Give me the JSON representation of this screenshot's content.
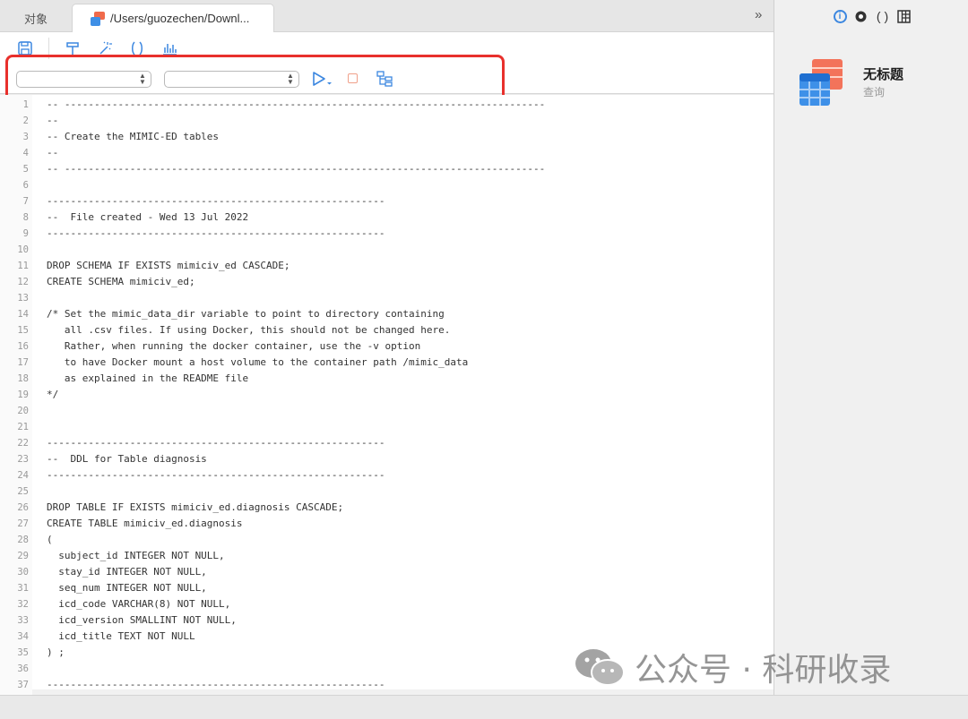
{
  "tabs": {
    "objects_label": "对象",
    "file_label": "/Users/guozechen/Downl...",
    "expand_glyph": "»"
  },
  "editor": {
    "lines": [
      {
        "n": "1",
        "text": "-- ---------------------------------------------------------------------------------"
      },
      {
        "n": "2",
        "text": "--"
      },
      {
        "n": "3",
        "text": "-- Create the MIMIC-ED tables"
      },
      {
        "n": "4",
        "text": "--"
      },
      {
        "n": "5",
        "text": "-- ---------------------------------------------------------------------------------"
      },
      {
        "n": "6",
        "text": ""
      },
      {
        "n": "7",
        "text": "---------------------------------------------------------"
      },
      {
        "n": "8",
        "text": "--  File created - Wed 13 Jul 2022"
      },
      {
        "n": "9",
        "text": "---------------------------------------------------------"
      },
      {
        "n": "10",
        "text": ""
      },
      {
        "n": "11",
        "text": "DROP SCHEMA IF EXISTS mimiciv_ed CASCADE;"
      },
      {
        "n": "12",
        "text": "CREATE SCHEMA mimiciv_ed;"
      },
      {
        "n": "13",
        "text": ""
      },
      {
        "n": "14",
        "text": "/* Set the mimic_data_dir variable to point to directory containing"
      },
      {
        "n": "15",
        "text": "   all .csv files. If using Docker, this should not be changed here."
      },
      {
        "n": "16",
        "text": "   Rather, when running the docker container, use the -v option"
      },
      {
        "n": "17",
        "text": "   to have Docker mount a host volume to the container path /mimic_data"
      },
      {
        "n": "18",
        "text": "   as explained in the README file"
      },
      {
        "n": "19",
        "text": "*/"
      },
      {
        "n": "20",
        "text": ""
      },
      {
        "n": "21",
        "text": ""
      },
      {
        "n": "22",
        "text": "---------------------------------------------------------"
      },
      {
        "n": "23",
        "text": "--  DDL for Table diagnosis"
      },
      {
        "n": "24",
        "text": "---------------------------------------------------------"
      },
      {
        "n": "25",
        "text": ""
      },
      {
        "n": "26",
        "text": "DROP TABLE IF EXISTS mimiciv_ed.diagnosis CASCADE;"
      },
      {
        "n": "27",
        "text": "CREATE TABLE mimiciv_ed.diagnosis"
      },
      {
        "n": "28",
        "text": "("
      },
      {
        "n": "29",
        "text": "  subject_id INTEGER NOT NULL,"
      },
      {
        "n": "30",
        "text": "  stay_id INTEGER NOT NULL,"
      },
      {
        "n": "31",
        "text": "  seq_num INTEGER NOT NULL,"
      },
      {
        "n": "32",
        "text": "  icd_code VARCHAR(8) NOT NULL,"
      },
      {
        "n": "33",
        "text": "  icd_version SMALLINT NOT NULL,"
      },
      {
        "n": "34",
        "text": "  icd_title TEXT NOT NULL"
      },
      {
        "n": "35",
        "text": ") ;"
      },
      {
        "n": "36",
        "text": ""
      },
      {
        "n": "37",
        "text": "---------------------------------------------------------"
      }
    ]
  },
  "right_pane": {
    "title": "无标题",
    "subtitle": "查询",
    "icons": [
      "info-icon",
      "eye-icon",
      "braces-icon",
      "columns-icon"
    ]
  },
  "watermark": {
    "text": "公众号 · 科研收录"
  },
  "colors": {
    "accent": "#3c87e0",
    "highlight": "#e8302c"
  }
}
